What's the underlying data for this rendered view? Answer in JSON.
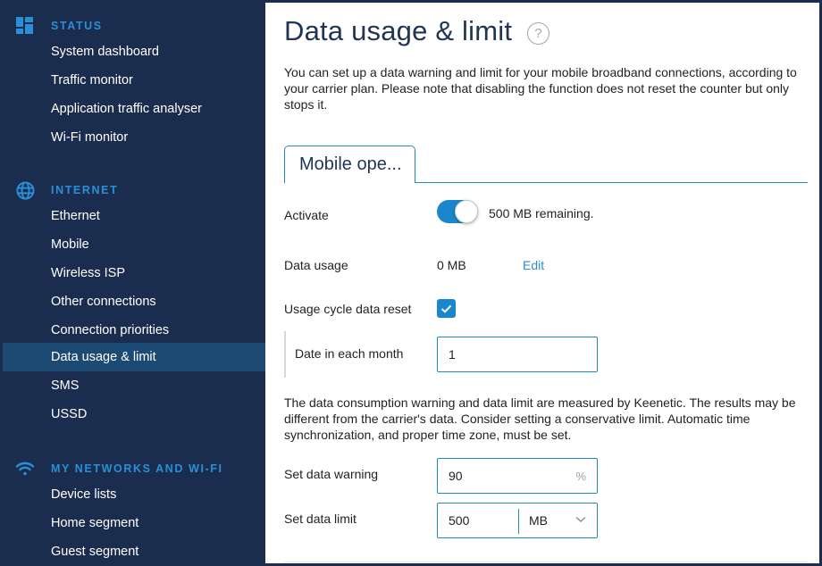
{
  "sidebar": {
    "sections": [
      {
        "title": "STATUS",
        "icon": "dashboard-icon",
        "items": [
          {
            "label": "System dashboard"
          },
          {
            "label": "Traffic monitor"
          },
          {
            "label": "Application traffic analyser"
          },
          {
            "label": "Wi-Fi monitor"
          }
        ]
      },
      {
        "title": "INTERNET",
        "icon": "globe-icon",
        "items": [
          {
            "label": "Ethernet"
          },
          {
            "label": "Mobile"
          },
          {
            "label": "Wireless ISP"
          },
          {
            "label": "Other connections"
          },
          {
            "label": "Connection priorities"
          },
          {
            "label": "Data usage & limit",
            "active": true
          },
          {
            "label": "SMS"
          },
          {
            "label": "USSD"
          }
        ]
      },
      {
        "title": "MY NETWORKS AND WI-FI",
        "icon": "wifi-icon",
        "items": [
          {
            "label": "Device lists"
          },
          {
            "label": "Home segment"
          },
          {
            "label": "Guest segment"
          }
        ]
      }
    ]
  },
  "main": {
    "title": "Data usage & limit",
    "help_icon": "?",
    "intro": "You can set up a data warning and limit for your mobile broadband connections, according to your carrier plan. Please note that disabling the function does not reset the counter but only stops it.",
    "tab": {
      "label": "Mobile ope..."
    },
    "activate": {
      "label": "Activate",
      "enabled": true,
      "status": "500 MB remaining."
    },
    "data_usage": {
      "label": "Data usage",
      "value": "0 MB",
      "edit_label": "Edit"
    },
    "cycle_reset": {
      "label": "Usage cycle data reset",
      "checked": true
    },
    "date_in_month": {
      "label": "Date in each month",
      "value": "1"
    },
    "note": "The data consumption warning and data limit are measured by Keenetic. The results may be different from the carrier's data. Consider setting a conservative limit. Automatic time synchronization, and proper time zone, must be set.",
    "data_warning": {
      "label": "Set data warning",
      "value": "90",
      "suffix": "%"
    },
    "data_limit": {
      "label": "Set data limit",
      "value": "500",
      "unit": "MB"
    }
  },
  "colors": {
    "sidebar_bg": "#1b2d4f",
    "sidebar_active": "#1c4a72",
    "accent": "#1a87cc",
    "section_title": "#2a8fd6",
    "title_text": "#1f3552"
  }
}
